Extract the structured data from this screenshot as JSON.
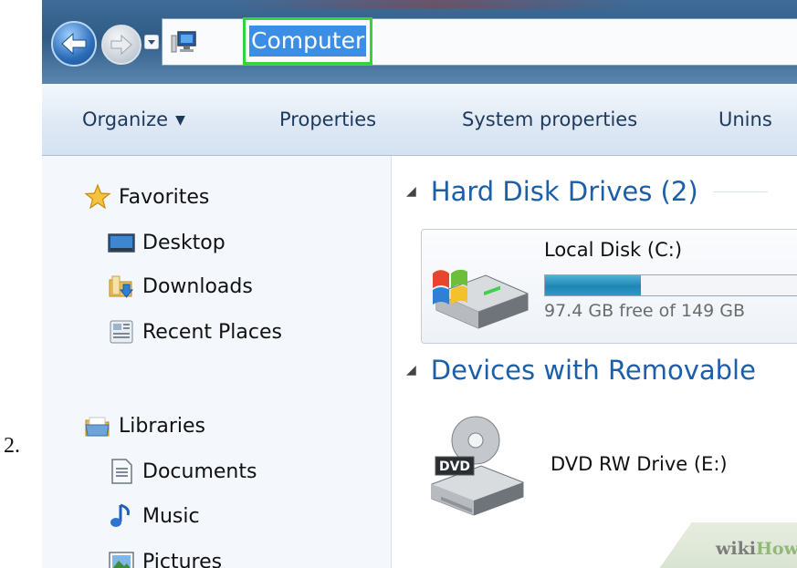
{
  "step": "2.",
  "address_bar": {
    "location": "Computer",
    "back_icon": "back-arrow-icon",
    "forward_icon": "forward-arrow-icon",
    "location_icon": "computer-icon"
  },
  "toolbar": {
    "organize": "Organize",
    "properties": "Properties",
    "system_properties": "System properties",
    "uninstall_partial": "Unins"
  },
  "nav_pane": {
    "favorites": {
      "label": "Favorites",
      "icon": "star-icon"
    },
    "favorites_items": [
      {
        "label": "Desktop",
        "icon": "desktop-icon"
      },
      {
        "label": "Downloads",
        "icon": "downloads-folder-icon"
      },
      {
        "label": "Recent Places",
        "icon": "recent-places-icon"
      }
    ],
    "libraries": {
      "label": "Libraries",
      "icon": "libraries-icon"
    },
    "libraries_items": [
      {
        "label": "Documents",
        "icon": "documents-icon"
      },
      {
        "label": "Music",
        "icon": "music-icon"
      },
      {
        "label": "Pictures",
        "icon": "pictures-icon"
      }
    ]
  },
  "content": {
    "hard_disk_group": "Hard Disk Drives (2)",
    "local_disk": {
      "name": "Local Disk (C:)",
      "free_text": "97.4 GB free of 149 GB",
      "used_fraction": 0.35,
      "icon": "windows-hard-drive-icon"
    },
    "removable_group": "Devices with Removable",
    "dvd_drive": {
      "name": "DVD RW Drive (E:)",
      "badge": "DVD",
      "icon": "dvd-drive-icon"
    }
  },
  "watermark": {
    "part1": "wiki",
    "part2": "How"
  },
  "colors": {
    "highlight_border": "#3ad23a",
    "selection": "#3a8ee6",
    "group_heading": "#1d5ea8",
    "usage_bar": "#1f86b4"
  }
}
